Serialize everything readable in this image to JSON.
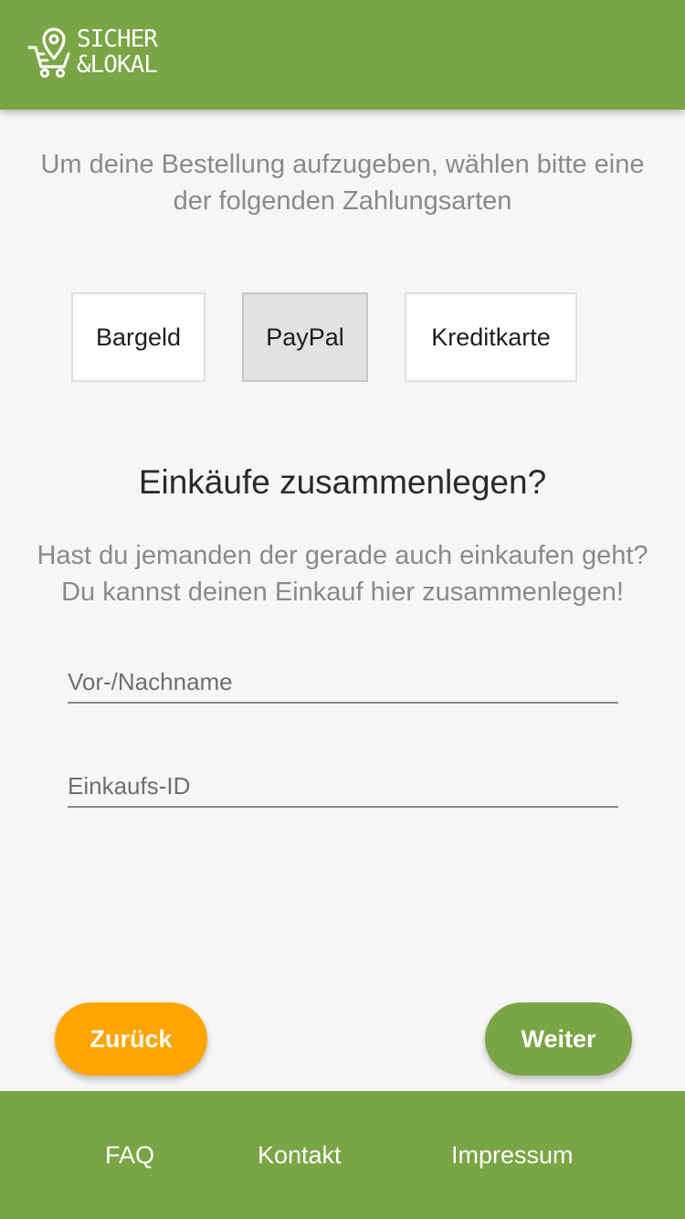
{
  "header": {
    "logo": {
      "icon": "shopping-cart-location-pin-icon",
      "line1": "SICHER",
      "line2": "&LOKAL"
    }
  },
  "intro": {
    "line1": "Um deine Bestellung aufzugeben, wählen bitte eine",
    "line2": "der folgenden Zahlungsarten"
  },
  "payment_methods": [
    {
      "label": "Bargeld",
      "selected": false
    },
    {
      "label": "PayPal",
      "selected": true
    },
    {
      "label": "Kreditkarte",
      "selected": false
    }
  ],
  "merge": {
    "title": "Einkäufe zusammenlegen?",
    "desc_line1": "Hast du jemanden der gerade auch einkaufen geht?",
    "desc_line2": "Du kannst deinen Einkauf hier zusammenlegen!",
    "name_field": {
      "placeholder": "Vor-/Nachname",
      "value": ""
    },
    "id_field": {
      "placeholder": "Einkaufs-ID",
      "value": ""
    }
  },
  "actions": {
    "back_label": "Zurück",
    "next_label": "Weiter"
  },
  "footer": {
    "links": [
      "FAQ",
      "Kontakt",
      "Impressum"
    ]
  },
  "colors": {
    "brand_green": "#79a544",
    "back_orange": "#ffa500",
    "background": "#f6f6f6",
    "selected_gray": "#e2e2e2"
  }
}
